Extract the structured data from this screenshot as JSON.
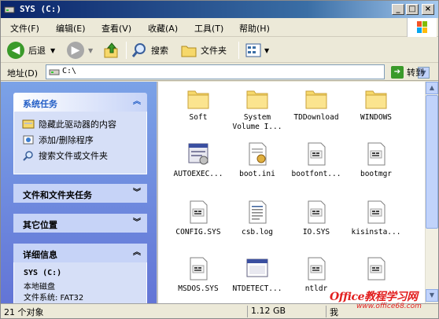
{
  "window": {
    "title": "SYS (C:)"
  },
  "title_buttons": {
    "minimize": "_",
    "maximize": "□",
    "close": "×"
  },
  "menu": [
    "文件(F)",
    "编辑(E)",
    "查看(V)",
    "收藏(A)",
    "工具(T)",
    "帮助(H)"
  ],
  "toolbar": {
    "back_label": "后退",
    "search_label": "搜索",
    "folders_label": "文件夹"
  },
  "address": {
    "label": "地址(D)",
    "value": "C:\\",
    "go_label": "转到"
  },
  "left_pane": {
    "system_tasks": {
      "title": "系统任务",
      "items": [
        "隐藏此驱动器的内容",
        "添加/删除程序",
        "搜索文件或文件夹"
      ]
    },
    "file_folder_tasks": {
      "title": "文件和文件夹任务"
    },
    "other_places": {
      "title": "其它位置"
    },
    "details": {
      "title": "详细信息",
      "name": "SYS (C:)",
      "type": "本地磁盘",
      "fs": "文件系统: FAT32"
    }
  },
  "files": [
    {
      "name": "Soft",
      "icon": "folder-icon"
    },
    {
      "name": "System\nVolume I...",
      "icon": "folder-icon"
    },
    {
      "name": "TDDownload",
      "icon": "folder-icon"
    },
    {
      "name": "WINDOWS",
      "icon": "folder-icon"
    },
    {
      "name": "AUTOEXEC...",
      "icon": "batch-file-icon"
    },
    {
      "name": "boot.ini",
      "icon": "config-file-icon"
    },
    {
      "name": "bootfont...",
      "icon": "system-file-icon"
    },
    {
      "name": "bootmgr",
      "icon": "system-file-icon"
    },
    {
      "name": "CONFIG.SYS",
      "icon": "system-file-icon"
    },
    {
      "name": "csb.log",
      "icon": "text-file-icon"
    },
    {
      "name": "IO.SYS",
      "icon": "system-file-icon"
    },
    {
      "name": "kisinsta...",
      "icon": "system-file-icon"
    },
    {
      "name": "MSDOS.SYS",
      "icon": "system-file-icon"
    },
    {
      "name": "NTDETECT...",
      "icon": "application-icon"
    },
    {
      "name": "ntldr",
      "icon": "system-file-icon"
    },
    {
      "name": "",
      "icon": "system-file-icon"
    }
  ],
  "status": {
    "count": "21 个对象",
    "size": "1.12 GB",
    "location": "我"
  },
  "watermark": {
    "brand": "Office教程学习网",
    "url": "www.office68.com"
  },
  "colors": {
    "title_start": "#0a246a",
    "task_link": "#215dc6",
    "watermark": "#e21f1f"
  }
}
